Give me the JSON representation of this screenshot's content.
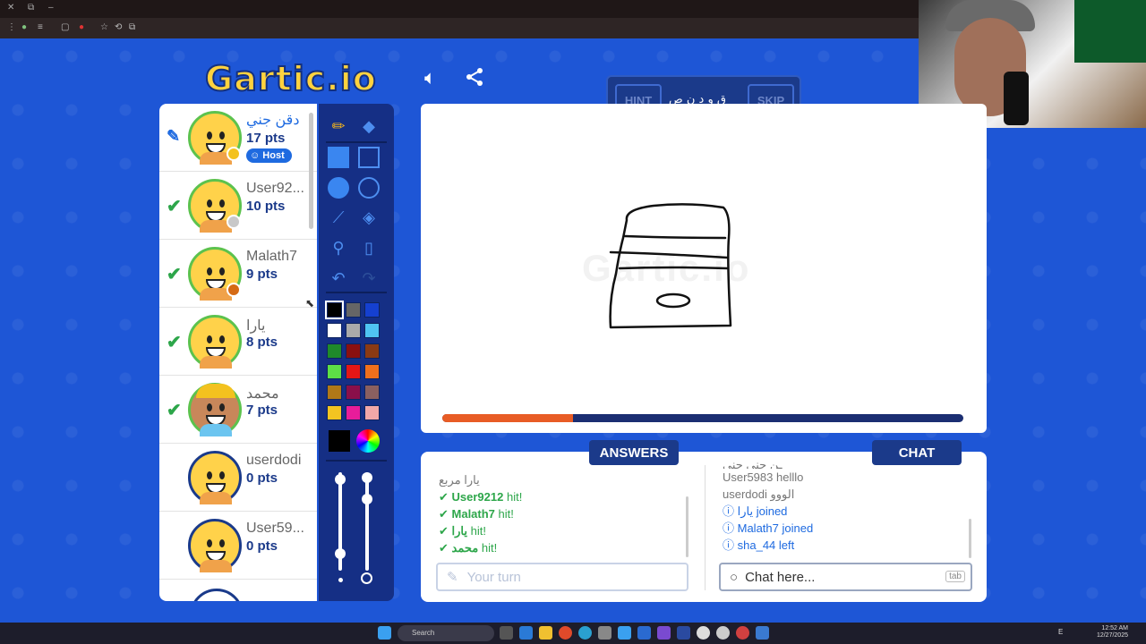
{
  "browser": {
    "min": "–",
    "restore": "⧉",
    "close": "✕"
  },
  "header": {
    "logo": "Gartic.io"
  },
  "players": [
    {
      "name": "دقن جني",
      "pts": "17 pts",
      "status": "drawing",
      "badge": "Host",
      "dot": "#f3c21f",
      "border": "green"
    },
    {
      "name": "User92...",
      "pts": "10 pts",
      "status": "hit",
      "dot": "#c8c8c8",
      "border": "green"
    },
    {
      "name": "Malath7",
      "pts": "9 pts",
      "status": "hit",
      "dot": "#d56a14",
      "border": "green"
    },
    {
      "name": "يارا",
      "pts": "8 pts",
      "status": "hit",
      "dot": "",
      "border": "green"
    },
    {
      "name": "محمد",
      "pts": "7 pts",
      "status": "hit",
      "dot": "",
      "border": "green"
    },
    {
      "name": "userdodi",
      "pts": "0 pts",
      "status": "",
      "dot": "",
      "border": "blue"
    },
    {
      "name": "User59...",
      "pts": "0 pts",
      "status": "",
      "dot": "",
      "border": "blue"
    }
  ],
  "palette": [
    "#000000",
    "#666666",
    "#1540d0",
    "#ffffff",
    "#aaaaaa",
    "#4fc4f2",
    "#1f8a2a",
    "#8a1010",
    "#8a3a14",
    "#5de046",
    "#e51616",
    "#f0701c",
    "#b07818",
    "#8a0f4a",
    "#8a6060",
    "#f3c421",
    "#e81c9a",
    "#f2a8a8"
  ],
  "hint": {
    "hint_label": "HINT",
    "word": "ق و د ن ص",
    "skip_label": "SKIP"
  },
  "canvas": {
    "watermark": "Gartic.io",
    "progress": 0.25
  },
  "answers": {
    "tab_label": "ANSWERS",
    "faded": "يارا مربع",
    "items": [
      {
        "user": "User9212",
        "suffix": "hit!"
      },
      {
        "user": "Malath7",
        "suffix": "hit!"
      },
      {
        "user": "يارا",
        "suffix": "hit!"
      },
      {
        "user": "محمد",
        "suffix": "hit!"
      }
    ],
    "placeholder": "Your turn"
  },
  "chat": {
    "tab_label": "CHAT",
    "top_faded": "ـن جني جني",
    "messages": [
      {
        "user": "User5983",
        "text": "helllo"
      },
      {
        "user": "userdodi",
        "text": "الووو"
      }
    ],
    "events": [
      {
        "user": "يارا",
        "text": "joined"
      },
      {
        "user": "Malath7",
        "text": "joined"
      },
      {
        "user": "sha_44",
        "text": "left"
      }
    ],
    "placeholder": "Chat here...",
    "tab_key": "tab"
  },
  "taskbar": {
    "search": "Search",
    "time": "12:52 AM",
    "date": "12/27/2025",
    "lang": "E"
  }
}
